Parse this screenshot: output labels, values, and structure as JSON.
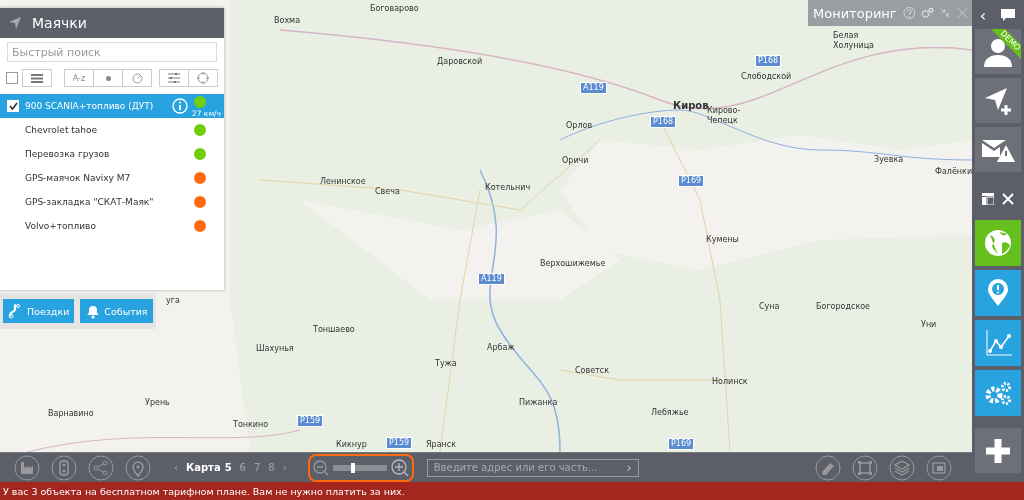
{
  "map": {
    "places": [
      {
        "name": "Вохма"
      },
      {
        "name": "Боговарово"
      },
      {
        "name": "Даровской"
      },
      {
        "name": "Киров"
      },
      {
        "name": "Слободской"
      },
      {
        "name": "Белая Холуница"
      },
      {
        "name": "Кирово-Чепецк"
      },
      {
        "name": "Орлов"
      },
      {
        "name": "Оричи"
      },
      {
        "name": "Зуевка"
      },
      {
        "name": "Фалёнки"
      },
      {
        "name": "Ленинское"
      },
      {
        "name": "Свеча"
      },
      {
        "name": "Котельнич"
      },
      {
        "name": "Кумены"
      },
      {
        "name": "Верхошижемье"
      },
      {
        "name": "Суна"
      },
      {
        "name": "Богородское"
      },
      {
        "name": "Уни"
      },
      {
        "name": "Тоншаево"
      },
      {
        "name": "Шахунья"
      },
      {
        "name": "Арбаж"
      },
      {
        "name": "Тужа"
      },
      {
        "name": "Советск"
      },
      {
        "name": "Нолинск"
      },
      {
        "name": "Пижанка"
      },
      {
        "name": "Лебяжье"
      },
      {
        "name": "Урень"
      },
      {
        "name": "Варнавино"
      },
      {
        "name": "Тонкино"
      },
      {
        "name": "Кикнур"
      },
      {
        "name": "Яранск"
      },
      {
        "name": "уга"
      }
    ],
    "roads": [
      {
        "name": "А119"
      },
      {
        "name": "Р168"
      },
      {
        "name": "Р169"
      },
      {
        "name": "А119"
      },
      {
        "name": "Р159"
      },
      {
        "name": "Р159"
      },
      {
        "name": "Р169"
      },
      {
        "name": "Р168"
      }
    ]
  },
  "beacons_panel": {
    "title": "Маячки",
    "search": {
      "placeholder": "Быстрый поиск"
    },
    "select_all": {
      "checked": false
    },
    "sort_label": "A-z",
    "items": [
      {
        "name": "900 SCANIA+топливо (ДУТ)",
        "selected": true,
        "color": "#6fcf0f",
        "speed": "27 км/ч"
      },
      {
        "name": "Chevrolet tahoe",
        "selected": false,
        "color": "#6fcf0f"
      },
      {
        "name": "Перевозка грузов",
        "selected": false,
        "color": "#6fcf0f"
      },
      {
        "name": "GPS-маячок Navixy M7",
        "selected": false,
        "color": "#ff6a10"
      },
      {
        "name": "GPS-закладка \"СКАТ-Маяк\"",
        "selected": false,
        "color": "#ff6a10"
      },
      {
        "name": "Volvo+топливо",
        "selected": false,
        "color": "#ff6a10"
      }
    ],
    "buttons": [
      {
        "kind": "trips",
        "label": "Поездки"
      },
      {
        "kind": "events",
        "label": "События"
      }
    ]
  },
  "monitoring": {
    "title": "Мониторинг"
  },
  "sidebar": {
    "collapse": "‹",
    "badge": "DEMO",
    "apps": [
      {
        "kind": "globe",
        "selected": true
      },
      {
        "kind": "places",
        "selected": false
      },
      {
        "kind": "chart",
        "selected": false
      },
      {
        "kind": "gears",
        "selected": false
      }
    ]
  },
  "bottom_bar": {
    "prev": "‹",
    "next": "›",
    "map_label": "Карта",
    "pages": [
      {
        "label": "5",
        "selected": true
      },
      {
        "label": "6",
        "selected": false
      },
      {
        "label": "7",
        "selected": false
      },
      {
        "label": "8",
        "selected": false
      }
    ],
    "zoom": {
      "level": 0.37
    },
    "address": {
      "placeholder": "Введите адрес или его часть...",
      "go": "›"
    }
  },
  "status_bar": {
    "message": "У вас 3 объекта на бесплатном тарифном плане. Вам не нужно платить за них."
  }
}
